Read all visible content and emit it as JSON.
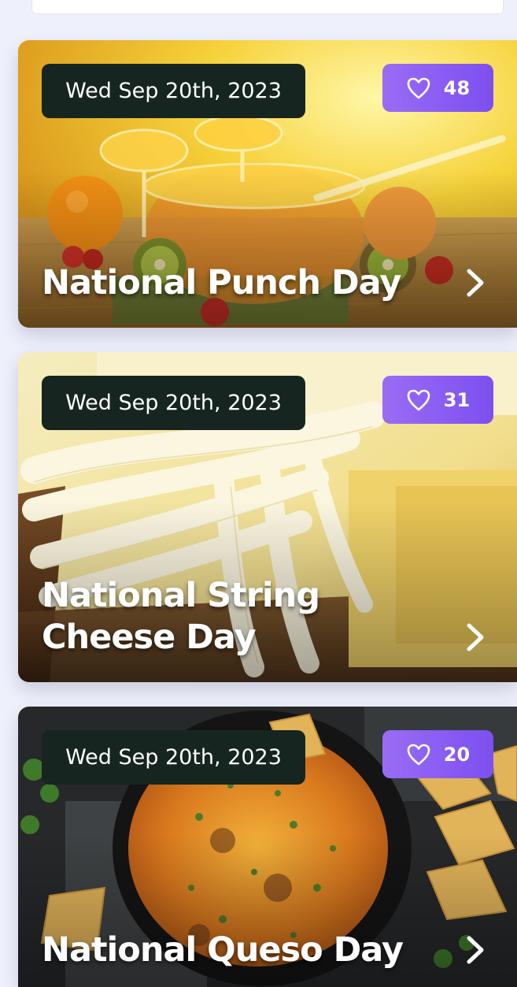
{
  "cards": [
    {
      "date": "Wed Sep 20th, 2023",
      "likes": "48",
      "title": "National Punch Day",
      "icons": {
        "like": "heart-outline-icon",
        "open": "chevron-right-icon"
      }
    },
    {
      "date": "Wed Sep 20th, 2023",
      "likes": "31",
      "title": "National String Cheese Day",
      "icons": {
        "like": "heart-outline-icon",
        "open": "chevron-right-icon"
      }
    },
    {
      "date": "Wed Sep 20th, 2023",
      "likes": "20",
      "title": "National Queso Day",
      "icons": {
        "like": "heart-outline-icon",
        "open": "chevron-right-icon"
      }
    }
  ],
  "colors": {
    "background": "#eef0fb",
    "date_pill": "#16251f",
    "like_pill": "#8a5cf2",
    "text": "#ffffff"
  }
}
